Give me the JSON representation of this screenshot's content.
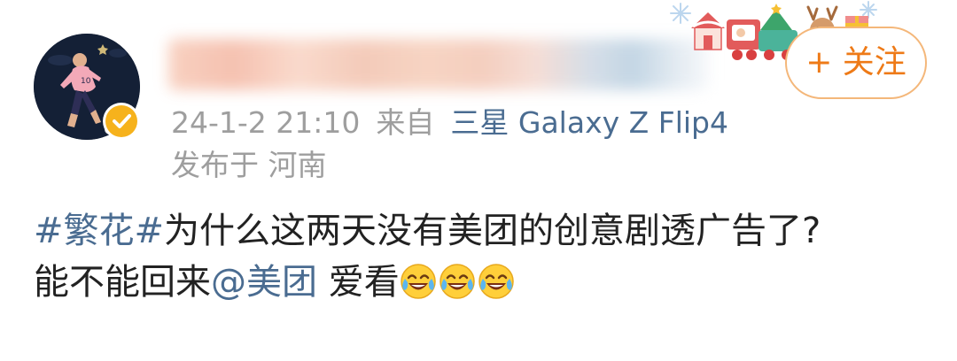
{
  "author": {
    "name": "",
    "avatar_icon": "avatar-soccer-player",
    "verified_icon": "verified-badge-icon"
  },
  "follow_button": {
    "label": "+ 关注"
  },
  "post": {
    "time": "24-1-2 21:10",
    "source_prefix": "来自",
    "device": "三星 Galaxy Z Flip4",
    "location": "发布于 河南",
    "hashtag": "#繁花#",
    "text_line1": "为什么这两天没有美团的创意剧透广告了?",
    "text_line2_a": "能不能回来",
    "mention": "@美团",
    "text_line2_b": "爱看",
    "emoji_count": 3,
    "emoji_name": "laugh-cry-emoji"
  },
  "colors": {
    "link": "#4a6c91",
    "meta": "#9e9e9e",
    "follow_accent": "#ee7a17",
    "follow_border": "#f4b77a",
    "text": "#222222"
  }
}
